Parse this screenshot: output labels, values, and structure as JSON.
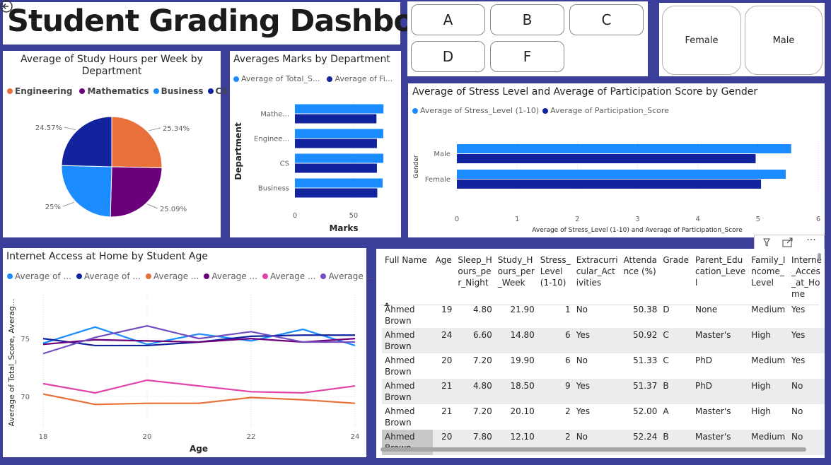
{
  "dashboard": {
    "title": "Student Grading Dashbooad",
    "back_icon": "back-arrow-icon"
  },
  "grade_slicer": {
    "options": [
      "A",
      "B",
      "C",
      "D",
      "F"
    ]
  },
  "gender_slicer": {
    "options": [
      "Female",
      "Male"
    ]
  },
  "pie": {
    "title_line1": "Average of Study Hours per Week by",
    "title_line2": "Department",
    "slices": [
      {
        "name": "Engineering",
        "label": "25.34%",
        "value": 25.34,
        "color": "#e8703a"
      },
      {
        "name": "Mathematics",
        "label": "25.09%",
        "value": 25.09,
        "color": "#6b007b"
      },
      {
        "name": "Business",
        "label": "25%",
        "value": 25.0,
        "color": "#1a8cff"
      },
      {
        "name": "CS",
        "label": "24.57%",
        "value": 24.57,
        "color": "#12239e"
      }
    ]
  },
  "dept_bar": {
    "title": "Averages Marks by Department",
    "legend": [
      "Average of Total_S...",
      "Average of Fi..."
    ],
    "ylabel": "Department",
    "xlabel": "Marks",
    "xticks": [
      "0",
      "50"
    ],
    "colors": [
      "#1a8cff",
      "#12239e"
    ],
    "categories": [
      "Mathe...",
      "Enginee...",
      "CS",
      "Business"
    ]
  },
  "gender_bar": {
    "title": "Average of Stress Level and Average of Participation Score by Gender",
    "legend": [
      "Average of Stress_Level (1-10)",
      "Average of Participation_Score"
    ],
    "ylabel": "Gender",
    "xlabel": "Average of Stress_Level (1-10) and Average of Participation_Score",
    "xticks": [
      "0",
      "1",
      "2",
      "3",
      "4",
      "5",
      "6"
    ],
    "colors": [
      "#1a8cff",
      "#12239e"
    ],
    "categories": [
      "Male",
      "Female"
    ]
  },
  "line": {
    "title": "Internet Access at Home by Student Age",
    "legend": [
      "Average of ...",
      "Average of ...",
      "Average ...",
      "Average ...",
      "Average ...",
      "Average ..."
    ],
    "ylabel": "Average of Total_Score, Averag...",
    "xlabel": "Age",
    "xticks": [
      "18",
      "20",
      "22",
      "24"
    ],
    "yticks": [
      "70",
      "75"
    ],
    "colors": [
      "#1a8cff",
      "#12239e",
      "#e8703a",
      "#6b007b",
      "#e044a7",
      "#744ec2"
    ]
  },
  "chart_data": [
    {
      "type": "pie",
      "title": "Average of Study Hours per Week by Department",
      "categories": [
        "Engineering",
        "Mathematics",
        "Business",
        "CS"
      ],
      "values": [
        25.34,
        25.09,
        25.0,
        24.57
      ],
      "legend_position": "top"
    },
    {
      "type": "bar",
      "title": "Averages Marks by Department",
      "orientation": "horizontal",
      "categories": [
        "Mathe...",
        "Enginee...",
        "CS",
        "Business"
      ],
      "xlabel": "Marks",
      "ylabel": "Department",
      "xlim": [
        0,
        85
      ],
      "series": [
        {
          "name": "Average of Total_S...",
          "values": [
            75.5,
            75.3,
            75.4,
            74.8
          ]
        },
        {
          "name": "Average of Fi...",
          "values": [
            69.5,
            69.9,
            69.9,
            70.2
          ]
        }
      ]
    },
    {
      "type": "bar",
      "title": "Average of Stress Level and Average of Participation Score by Gender",
      "orientation": "horizontal",
      "categories": [
        "Male",
        "Female"
      ],
      "xlabel": "Average of Stress_Level (1-10) and Average of Participation_Score",
      "ylabel": "Gender",
      "xlim": [
        0,
        6
      ],
      "series": [
        {
          "name": "Average of Stress_Level (1-10)",
          "values": [
            5.55,
            5.46
          ]
        },
        {
          "name": "Average of Participation_Score",
          "values": [
            4.96,
            5.05
          ]
        }
      ]
    },
    {
      "type": "line",
      "title": "Internet Access at Home by Student Age",
      "x": [
        18,
        19,
        20,
        21,
        22,
        23,
        24
      ],
      "xlabel": "Age",
      "ylabel": "Average of Total_Score, Averag...",
      "ylim": [
        67.3,
        78.8
      ],
      "series": [
        {
          "name": "Average of ...",
          "values": [
            74.6,
            76.0,
            74.5,
            75.4,
            74.8,
            75.8,
            74.4
          ]
        },
        {
          "name": "Average of ...",
          "values": [
            75.0,
            74.4,
            74.4,
            74.7,
            75.2,
            75.3,
            75.3
          ]
        },
        {
          "name": "Average ...",
          "values": [
            70.2,
            69.3,
            69.4,
            69.4,
            69.9,
            69.7,
            69.4
          ]
        },
        {
          "name": "Average ...",
          "values": [
            74.5,
            74.9,
            74.8,
            74.7,
            75.0,
            74.7,
            75.0
          ]
        },
        {
          "name": "Average ...",
          "values": [
            71.1,
            70.3,
            71.4,
            70.9,
            70.4,
            70.3,
            70.9
          ]
        },
        {
          "name": "Average ...",
          "values": [
            73.7,
            75.1,
            76.1,
            75.0,
            75.6,
            74.7,
            74.7
          ]
        }
      ]
    }
  ],
  "table": {
    "headers": [
      [
        "Full Name"
      ],
      [
        "Age"
      ],
      [
        "Sleep_H",
        "ours_pe",
        "r_Night"
      ],
      [
        "Study_H",
        "ours_per",
        "_Week"
      ],
      [
        "Stress_",
        "Level",
        "(1-10)"
      ],
      [
        "Extracurri",
        "cular_Act",
        "ivities"
      ],
      [
        "Attenda",
        "nce (%)"
      ],
      [
        "Grade"
      ],
      [
        "Parent_Edu",
        "cation_Leve",
        "l"
      ],
      [
        "Family_I",
        "ncome_",
        "Level"
      ],
      [
        "Interne",
        "_Acces",
        "_at_Ho",
        "me"
      ]
    ],
    "rows": [
      [
        "Ahmed Brown",
        "19",
        "4.80",
        "21.90",
        "1",
        "No",
        "50.38",
        "D",
        "None",
        "Medium",
        "Yes"
      ],
      [
        "Ahmed Brown",
        "24",
        "6.60",
        "14.80",
        "6",
        "Yes",
        "50.92",
        "C",
        "Master's",
        "High",
        "Yes"
      ],
      [
        "Ahmed Brown",
        "20",
        "7.20",
        "19.90",
        "6",
        "No",
        "51.33",
        "C",
        "PhD",
        "Medium",
        "Yes"
      ],
      [
        "Ahmed Brown",
        "21",
        "4.80",
        "18.50",
        "9",
        "Yes",
        "51.37",
        "B",
        "PhD",
        "High",
        "No"
      ],
      [
        "Ahmed Brown",
        "21",
        "7.20",
        "20.10",
        "2",
        "Yes",
        "52.00",
        "A",
        "Master's",
        "High",
        "No"
      ],
      [
        "Ahmed Brown",
        "20",
        "7.80",
        "12.10",
        "2",
        "No",
        "52.24",
        "B",
        "Master's",
        "Medium",
        "No"
      ]
    ],
    "sort_icon": "sort-ascending-icon",
    "visual_header_icons": [
      "filter-icon",
      "focus-mode-icon",
      "more-options-icon"
    ]
  }
}
